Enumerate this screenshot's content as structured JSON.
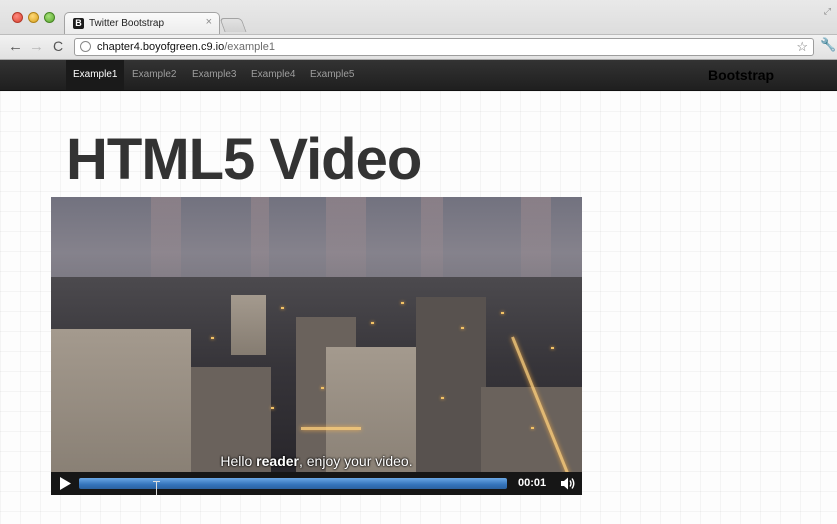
{
  "browser": {
    "tab_title": "Twitter Bootstrap",
    "tab_favicon": "B",
    "tab_close": "×",
    "url_host": "chapter4.boyofgreen.c9.io",
    "url_path": "/example1"
  },
  "icons": {
    "back": "←",
    "forward": "→",
    "reload": "C",
    "bookmark": "☆",
    "wrench": "🔧",
    "fullscreen": "⤢"
  },
  "navbar": {
    "items": [
      {
        "label": "Example1",
        "active": true
      },
      {
        "label": "Example2",
        "active": false
      },
      {
        "label": "Example3",
        "active": false
      },
      {
        "label": "Example4",
        "active": false
      },
      {
        "label": "Example5",
        "active": false
      }
    ],
    "brand": "Bootstrap"
  },
  "page": {
    "title": "HTML5 Video"
  },
  "video": {
    "caption_prefix": "Hello ",
    "caption_bold": "reader",
    "caption_suffix": ", enjoy your video.",
    "time": "00:01",
    "progress": 0.18
  }
}
